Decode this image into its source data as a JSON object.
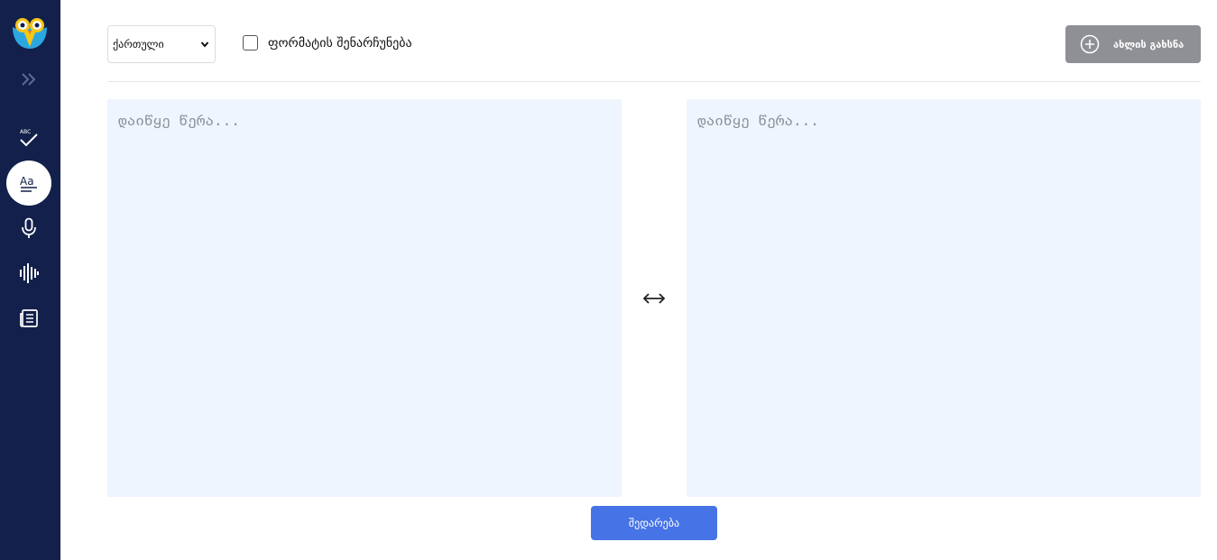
{
  "sidebar": {
    "items": [
      {
        "name": "spellcheck",
        "icon": "spellcheck-icon",
        "active": false
      },
      {
        "name": "text-compare",
        "icon": "text-format-icon",
        "active": true
      },
      {
        "name": "speech-to-text",
        "icon": "microphone-icon",
        "active": false
      },
      {
        "name": "audio",
        "icon": "soundwave-icon",
        "active": false
      },
      {
        "name": "articles",
        "icon": "newspaper-icon",
        "active": false
      }
    ],
    "expand_icon": "double-chevron-right-icon"
  },
  "toolbar": {
    "language_selected": "ქართული",
    "keep_format_label": "ფორმატის შენარჩუნება",
    "keep_format_checked": false,
    "open_new_label": "ახლის გახსნა"
  },
  "panels": {
    "left_placeholder": "დაიწყე წერა...",
    "right_placeholder": "დაიწყე წერა..."
  },
  "actions": {
    "compare_label": "შედარება"
  },
  "colors": {
    "sidebar_bg": "#13204b",
    "panel_bg": "#eff5fe",
    "primary": "#4673e6",
    "disabled_button": "#8f9096"
  }
}
